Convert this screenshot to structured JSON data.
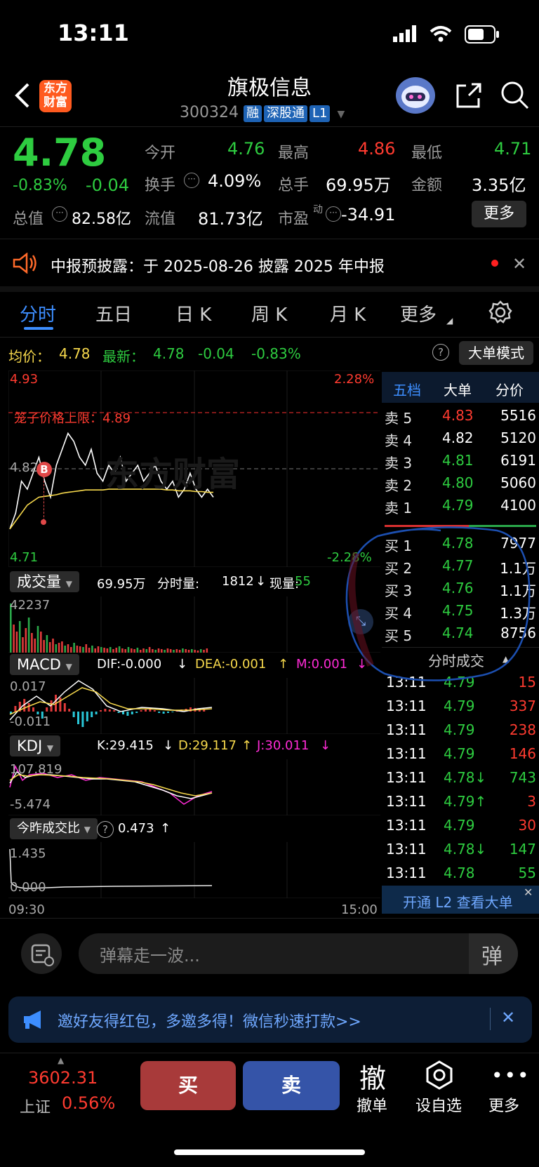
{
  "status": {
    "time": "13:11"
  },
  "header": {
    "logo_text": "东方\n财富",
    "title": "旗极信息",
    "code": "300324",
    "badges": [
      "融",
      "深股通",
      "L1"
    ]
  },
  "quote": {
    "price": "4.78",
    "change_pct": "-0.83%",
    "change": "-0.04",
    "open_label": "今开",
    "open": "4.76",
    "high_label": "最高",
    "high": "4.86",
    "low_label": "最低",
    "low": "4.71",
    "turnover_label": "换手",
    "turnover": "4.09%",
    "volume_label": "总手",
    "volume": "69.95万",
    "amount_label": "金额",
    "amount": "3.35亿",
    "mktcap_label": "总值",
    "mktcap": "82.58亿",
    "float_label": "流值",
    "float": "81.73亿",
    "pe_label": "市盈",
    "pe_sup": "动",
    "pe": "-34.91",
    "more": "更多"
  },
  "notice": {
    "text": "中报预披露：于 2025-08-26 披露 2025 年中报"
  },
  "tabs": [
    "分时",
    "五日",
    "日 K",
    "周 K",
    "月 K",
    "更多"
  ],
  "legend": {
    "avg_label": "均价：",
    "avg": "4.78",
    "latest_label": "最新：",
    "latest": "4.78",
    "latest_change": "-0.04",
    "latest_pct": "-0.83%",
    "mode_button": "大单模式"
  },
  "chart": {
    "top_price": "4.93",
    "top_pct": "2.28%",
    "limit_label": "笼子价格上限：4.89",
    "mid_price": "4.82",
    "bottom_price": "4.71",
    "bottom_pct": "-2.28%",
    "buy_marker": "B",
    "watermark": "东方财富",
    "time_start": "09:30",
    "time_end": "15:00"
  },
  "chart_data": {
    "type": "line",
    "ylim": [
      4.71,
      4.93
    ],
    "price": [
      4.74,
      4.76,
      4.8,
      4.79,
      4.81,
      4.83,
      4.8,
      4.78,
      4.82,
      4.84,
      4.86,
      4.85,
      4.83,
      4.82,
      4.84,
      4.81,
      4.8,
      4.82,
      4.81,
      4.83,
      4.8,
      4.81,
      4.82,
      4.8,
      4.81,
      4.82,
      4.8,
      4.79,
      4.8,
      4.78,
      4.79,
      4.81,
      4.79,
      4.78,
      4.79,
      4.78
    ],
    "average": [
      4.74,
      4.75,
      4.76,
      4.77,
      4.775,
      4.78,
      4.781,
      4.782,
      4.783,
      4.785,
      4.786,
      4.787,
      4.788,
      4.789,
      4.789,
      4.789,
      4.789,
      4.79,
      4.79,
      4.79,
      4.79,
      4.79,
      4.79,
      4.79,
      4.79,
      4.79,
      4.79,
      4.789,
      4.789,
      4.788,
      4.788,
      4.788,
      4.787,
      4.787,
      4.786,
      4.786
    ]
  },
  "volume_panel": {
    "title": "成交量",
    "total": "69.95万",
    "tick_label": "分时量:",
    "tick_val": "1812",
    "now_label": "现量:",
    "now_val": "55",
    "max": "42237"
  },
  "macd_panel": {
    "title": "MACD",
    "dif": "DIF:-0.000",
    "dea": "DEA:-0.001",
    "m": "M:0.001",
    "top": "0.017",
    "bottom": "-0.011"
  },
  "kdj_panel": {
    "title": "KDJ",
    "k": "K:29.415",
    "d": "D:29.117",
    "j": "J:30.011",
    "top": "107.819",
    "bottom": "-5.474"
  },
  "ratio_panel": {
    "title": "今昨成交比",
    "value": "0.473",
    "top": "1.435",
    "bottom": "0.000"
  },
  "book": {
    "tabs": [
      "五档",
      "大单",
      "分价"
    ],
    "asks": [
      {
        "label": "卖 5",
        "price": "4.83",
        "vol": "5516"
      },
      {
        "label": "卖 4",
        "price": "4.82",
        "vol": "5120"
      },
      {
        "label": "卖 3",
        "price": "4.81",
        "vol": "6191"
      },
      {
        "label": "卖 2",
        "price": "4.80",
        "vol": "5060"
      },
      {
        "label": "卖 1",
        "price": "4.79",
        "vol": "4100"
      }
    ],
    "bids": [
      {
        "label": "买 1",
        "price": "4.78",
        "vol": "7977"
      },
      {
        "label": "买 2",
        "price": "4.77",
        "vol": "1.1万"
      },
      {
        "label": "买 3",
        "price": "4.76",
        "vol": "1.1万"
      },
      {
        "label": "买 4",
        "price": "4.75",
        "vol": "1.3万"
      },
      {
        "label": "买 5",
        "price": "4.74",
        "vol": "8756"
      }
    ],
    "trades_title": "分时成交",
    "trades": [
      {
        "t": "13:11",
        "p": "4.79",
        "v": "15"
      },
      {
        "t": "13:11",
        "p": "4.79",
        "v": "337"
      },
      {
        "t": "13:11",
        "p": "4.79",
        "v": "238"
      },
      {
        "t": "13:11",
        "p": "4.79",
        "v": "146"
      },
      {
        "t": "13:11",
        "p": "4.78↓",
        "v": "743"
      },
      {
        "t": "13:11",
        "p": "4.79↑",
        "v": "3"
      },
      {
        "t": "13:11",
        "p": "4.79",
        "v": "30"
      },
      {
        "t": "13:11",
        "p": "4.78↓",
        "v": "147"
      },
      {
        "t": "13:11",
        "p": "4.78",
        "v": "55"
      }
    ],
    "l2_link": "开通 L2 查看大单"
  },
  "danmaku": {
    "placeholder": "弹幕走一波...",
    "btn": "弹"
  },
  "promo": {
    "text": "邀好友得红包，多邀多得！微信秒速打款>>"
  },
  "footer": {
    "index_value": "3602.31",
    "index_name": "上证",
    "index_pct": "0.56%",
    "buy": "买",
    "sell": "卖",
    "cancel_glyph": "撤",
    "cancel": "撤单",
    "watchlist": "设自选",
    "more": "更多"
  }
}
